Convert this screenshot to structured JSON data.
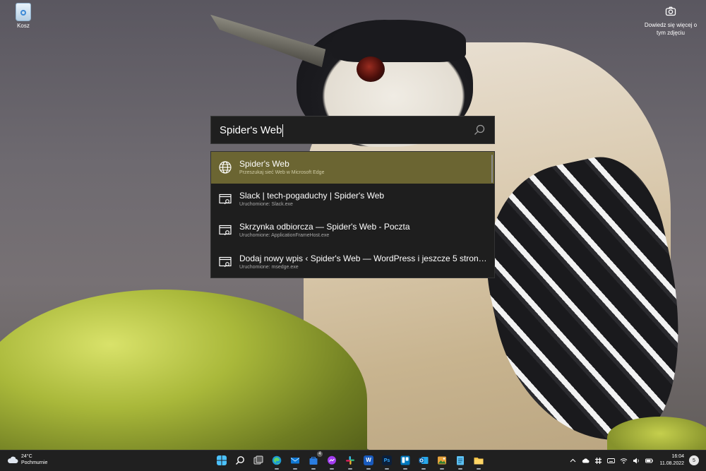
{
  "desktop": {
    "recycle_bin_label": "Kosz",
    "learn_more_label": "Dowiedz się więcej o tym zdjęciu"
  },
  "search": {
    "query": "Spider's Web"
  },
  "results": [
    {
      "title": "Spider's Web",
      "subtitle": "Przeszukaj sieć Web w Microsoft Edge",
      "icon": "globe-icon"
    },
    {
      "title": "Slack | tech-pogaduchy | Spider's Web",
      "subtitle": "Uruchomione: Slack.exe",
      "icon": "window-icon"
    },
    {
      "title": "Skrzynka odbiorcza — Spider's Web - Poczta",
      "subtitle": "Uruchomione: ApplicationFrameHost.exe",
      "icon": "window-icon"
    },
    {
      "title": "Dodaj nowy wpis ‹ Spider's Web — WordPress i jeszcze 5 stron —",
      "subtitle": "Uruchomione: msedge.exe",
      "icon": "window-icon"
    }
  ],
  "taskbar": {
    "weather_temp": "24°C",
    "weather_desc": "Pochmurnie",
    "store_badge": "4",
    "time": "16:04",
    "date": "11.08.2022",
    "notification_count": "5",
    "apps": [
      {
        "name": "start-button",
        "label": ""
      },
      {
        "name": "search-button",
        "label": ""
      },
      {
        "name": "task-view-button",
        "label": ""
      },
      {
        "name": "edge-app",
        "label": ""
      },
      {
        "name": "mail-app",
        "label": ""
      },
      {
        "name": "store-app",
        "label": ""
      },
      {
        "name": "messenger-app",
        "label": ""
      },
      {
        "name": "slack-app",
        "label": ""
      },
      {
        "name": "word-app",
        "label": "W"
      },
      {
        "name": "photoshop-app",
        "label": "Ps"
      },
      {
        "name": "trello-app",
        "label": ""
      },
      {
        "name": "outlook-app",
        "label": ""
      },
      {
        "name": "photos-app",
        "label": ""
      },
      {
        "name": "notepad-app",
        "label": ""
      },
      {
        "name": "explorer-app",
        "label": ""
      }
    ]
  },
  "colors": {
    "selected_result": "#6b6532",
    "panel_bg": "#1e1e1e",
    "taskbar_bg": "#202020"
  }
}
